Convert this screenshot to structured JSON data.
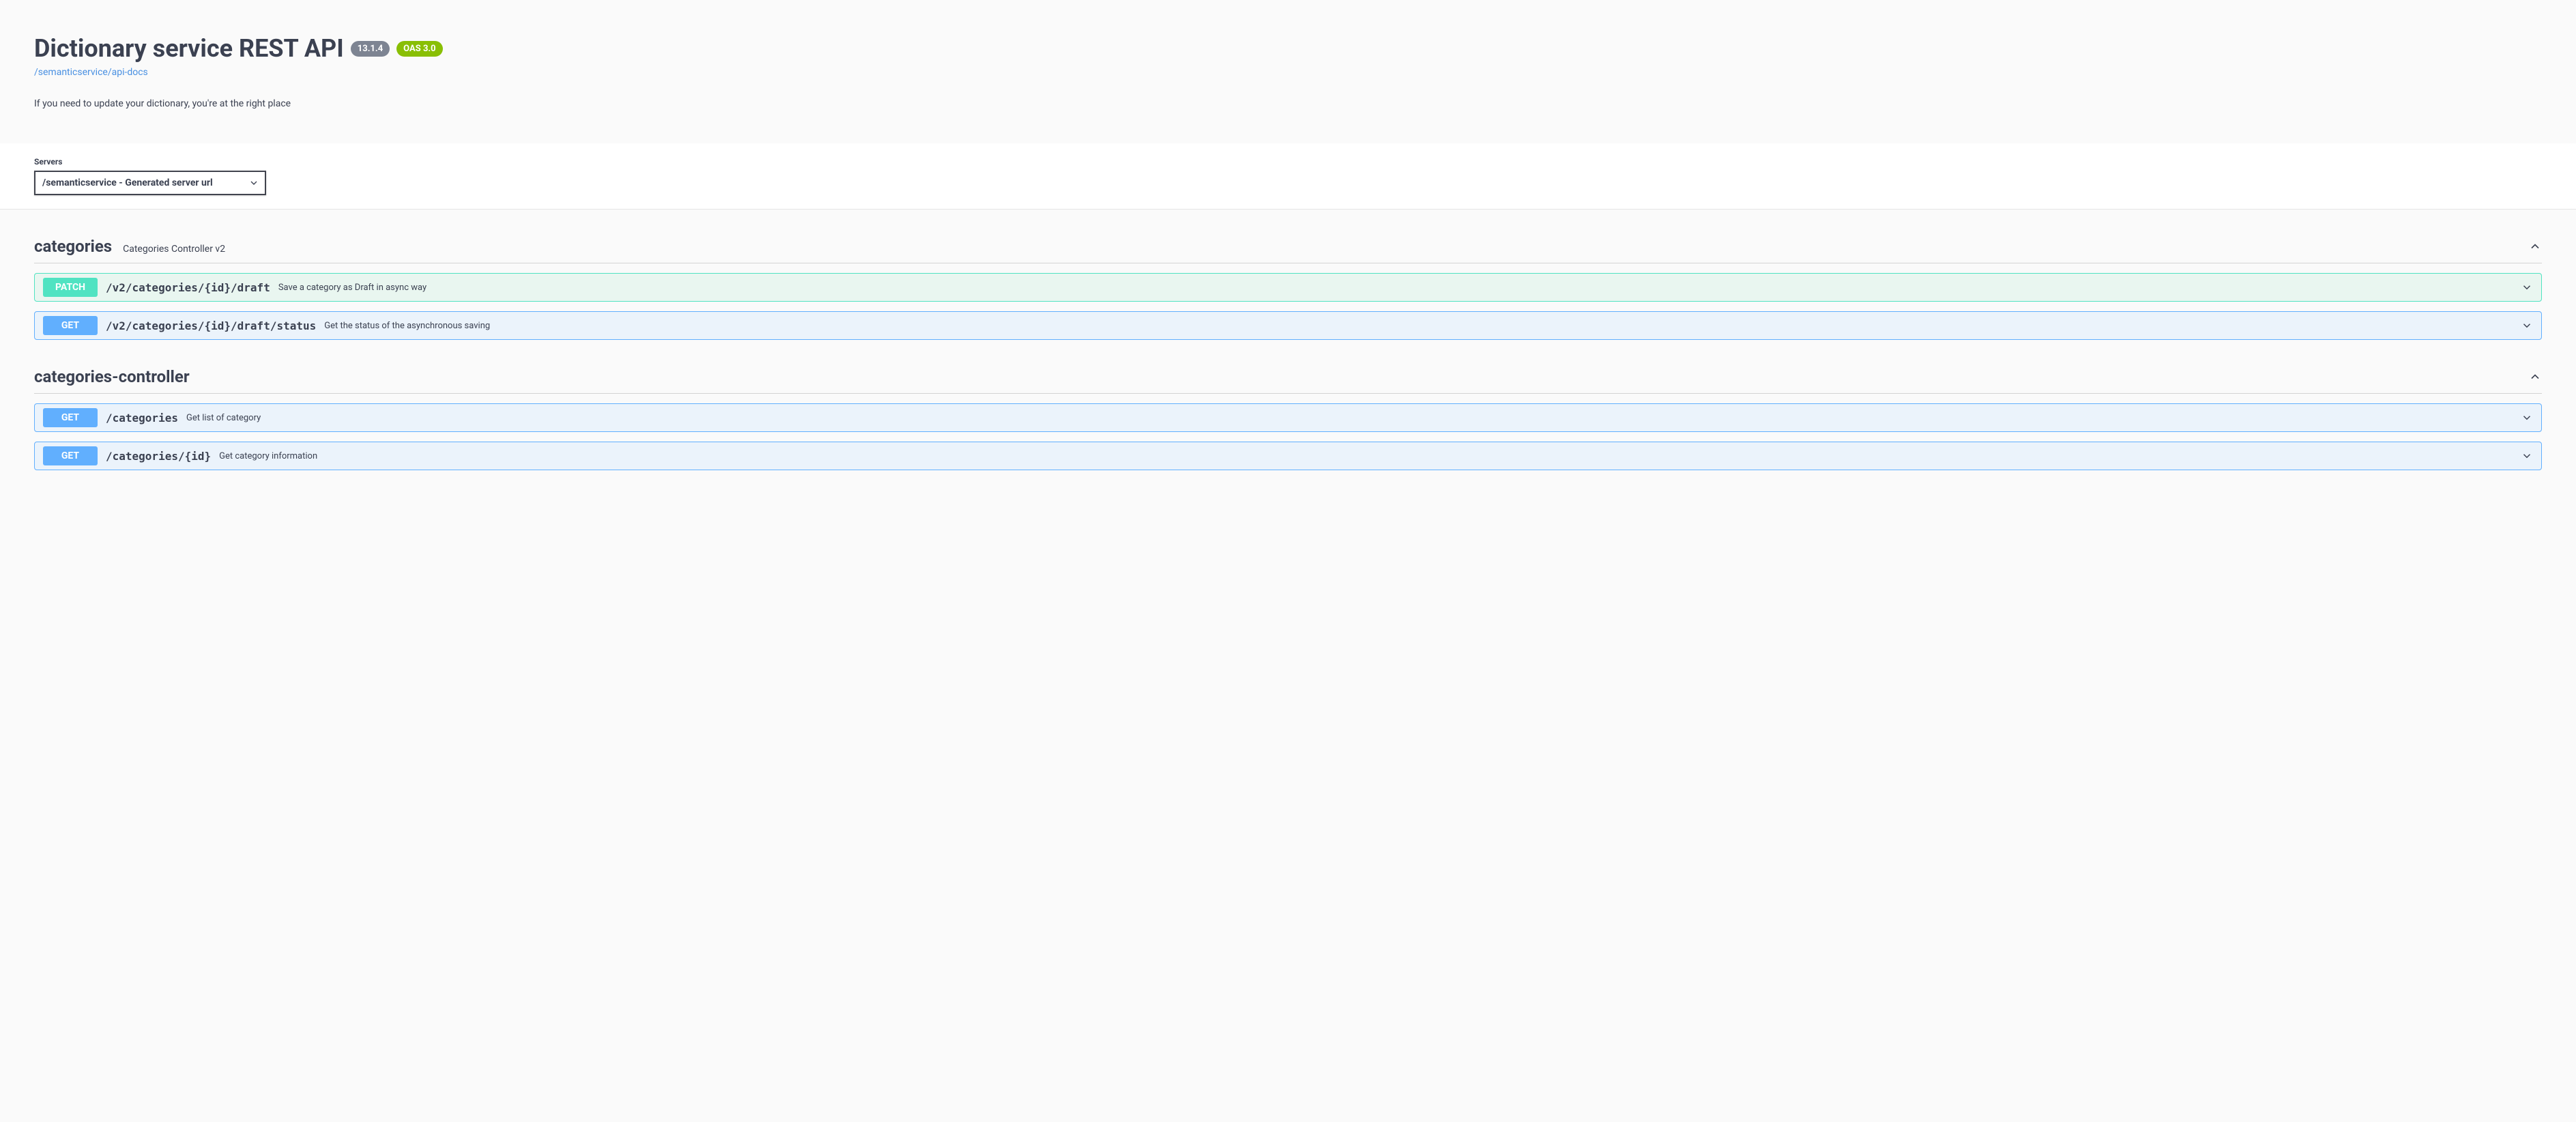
{
  "header": {
    "title": "Dictionary service REST API",
    "version": "13.1.4",
    "oas": "OAS 3.0",
    "api_link": "/semanticservice/api-docs",
    "description": "If you need to update your dictionary, you're at the right place"
  },
  "servers": {
    "label": "Servers",
    "selected": "/semanticservice - Generated server url"
  },
  "tags": [
    {
      "name": "categories",
      "description": "Categories Controller v2",
      "operations": [
        {
          "method": "PATCH",
          "path": "/v2/categories/{id}/draft",
          "summary": "Save a category as Draft in async way"
        },
        {
          "method": "GET",
          "path": "/v2/categories/{id}/draft/status",
          "summary": "Get the status of the asynchronous saving"
        }
      ]
    },
    {
      "name": "categories-controller",
      "description": "",
      "operations": [
        {
          "method": "GET",
          "path": "/categories",
          "summary": "Get list of category"
        },
        {
          "method": "GET",
          "path": "/categories/{id}",
          "summary": "Get category information"
        }
      ]
    }
  ]
}
